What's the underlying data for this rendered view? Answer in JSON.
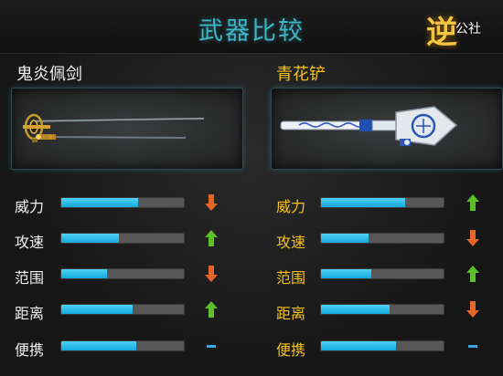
{
  "header": {
    "title": "武器比较",
    "logo_char": "逆",
    "logo_text": "公社"
  },
  "weapons": [
    {
      "name": "鬼炎佩剑",
      "stats": [
        {
          "label": "威力",
          "value": 0.63,
          "trend": "down"
        },
        {
          "label": "攻速",
          "value": 0.47,
          "trend": "up"
        },
        {
          "label": "范围",
          "value": 0.37,
          "trend": "down"
        },
        {
          "label": "距离",
          "value": 0.58,
          "trend": "up"
        },
        {
          "label": "便携",
          "value": 0.61,
          "trend": "same"
        }
      ]
    },
    {
      "name": "青花铲",
      "stats": [
        {
          "label": "威力",
          "value": 0.69,
          "trend": "up"
        },
        {
          "label": "攻速",
          "value": 0.39,
          "trend": "down"
        },
        {
          "label": "范围",
          "value": 0.41,
          "trend": "up"
        },
        {
          "label": "距离",
          "value": 0.56,
          "trend": "down"
        },
        {
          "label": "便携",
          "value": 0.61,
          "trend": "same"
        }
      ]
    }
  ],
  "colors": {
    "up": "#5cbf2a",
    "down": "#e4652a",
    "same": "#3aa7e0",
    "bar_fill": "#1fb6e6"
  },
  "icons": {
    "up": "arrow-up-icon",
    "down": "arrow-down-icon",
    "same": "dash-icon"
  }
}
